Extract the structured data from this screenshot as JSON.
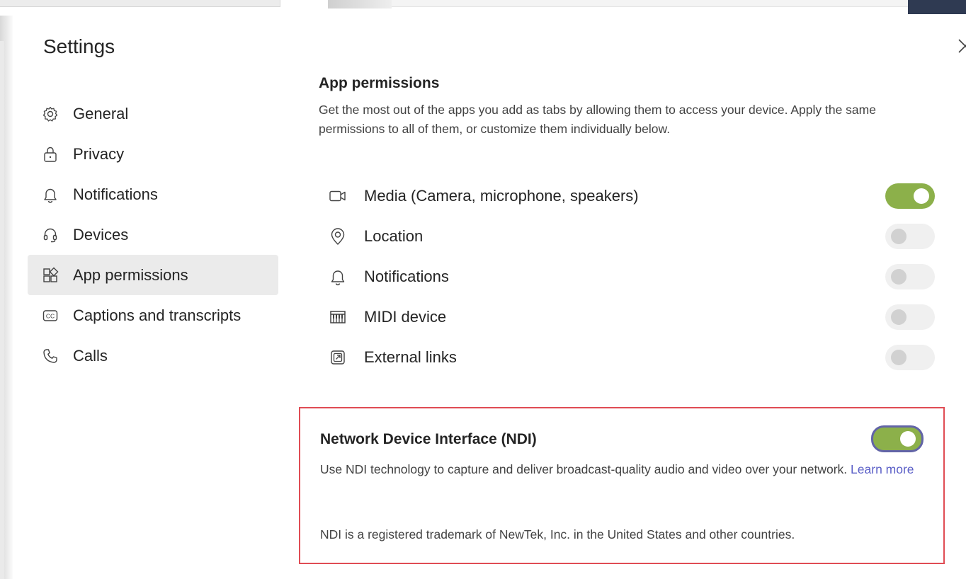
{
  "dialog": {
    "title": "Settings"
  },
  "nav": {
    "items": [
      {
        "label": "General",
        "icon": "gear-icon"
      },
      {
        "label": "Privacy",
        "icon": "lock-icon"
      },
      {
        "label": "Notifications",
        "icon": "bell-icon"
      },
      {
        "label": "Devices",
        "icon": "headset-icon"
      },
      {
        "label": "App permissions",
        "icon": "app-permissions-icon",
        "selected": true
      },
      {
        "label": "Captions and transcripts",
        "icon": "cc-icon"
      },
      {
        "label": "Calls",
        "icon": "phone-icon"
      }
    ]
  },
  "app_permissions": {
    "title": "App permissions",
    "description": "Get the most out of the apps you add as tabs by allowing them to access your device. Apply the same permissions to all of them, or customize them individually below.",
    "items": [
      {
        "label": "Media (Camera, microphone, speakers)",
        "icon": "camera-icon",
        "enabled": true
      },
      {
        "label": "Location",
        "icon": "location-pin-icon",
        "enabled": false
      },
      {
        "label": "Notifications",
        "icon": "bell-icon",
        "enabled": false
      },
      {
        "label": "MIDI device",
        "icon": "midi-keyboard-icon",
        "enabled": false
      },
      {
        "label": "External links",
        "icon": "external-link-icon",
        "enabled": false
      }
    ]
  },
  "ndi": {
    "title": "Network Device Interface (NDI)",
    "description": "Use NDI technology to capture and deliver broadcast-quality audio and video over your network.",
    "learn_more": "Learn more",
    "trademark": "NDI is a registered trademark of NewTek, Inc. in the United States and other countries.",
    "enabled": true
  },
  "colors": {
    "toggle_on": "#8cb04a",
    "focus_ring": "#6264a7",
    "highlight_box": "#e04c54",
    "link": "#5b5fc7"
  }
}
